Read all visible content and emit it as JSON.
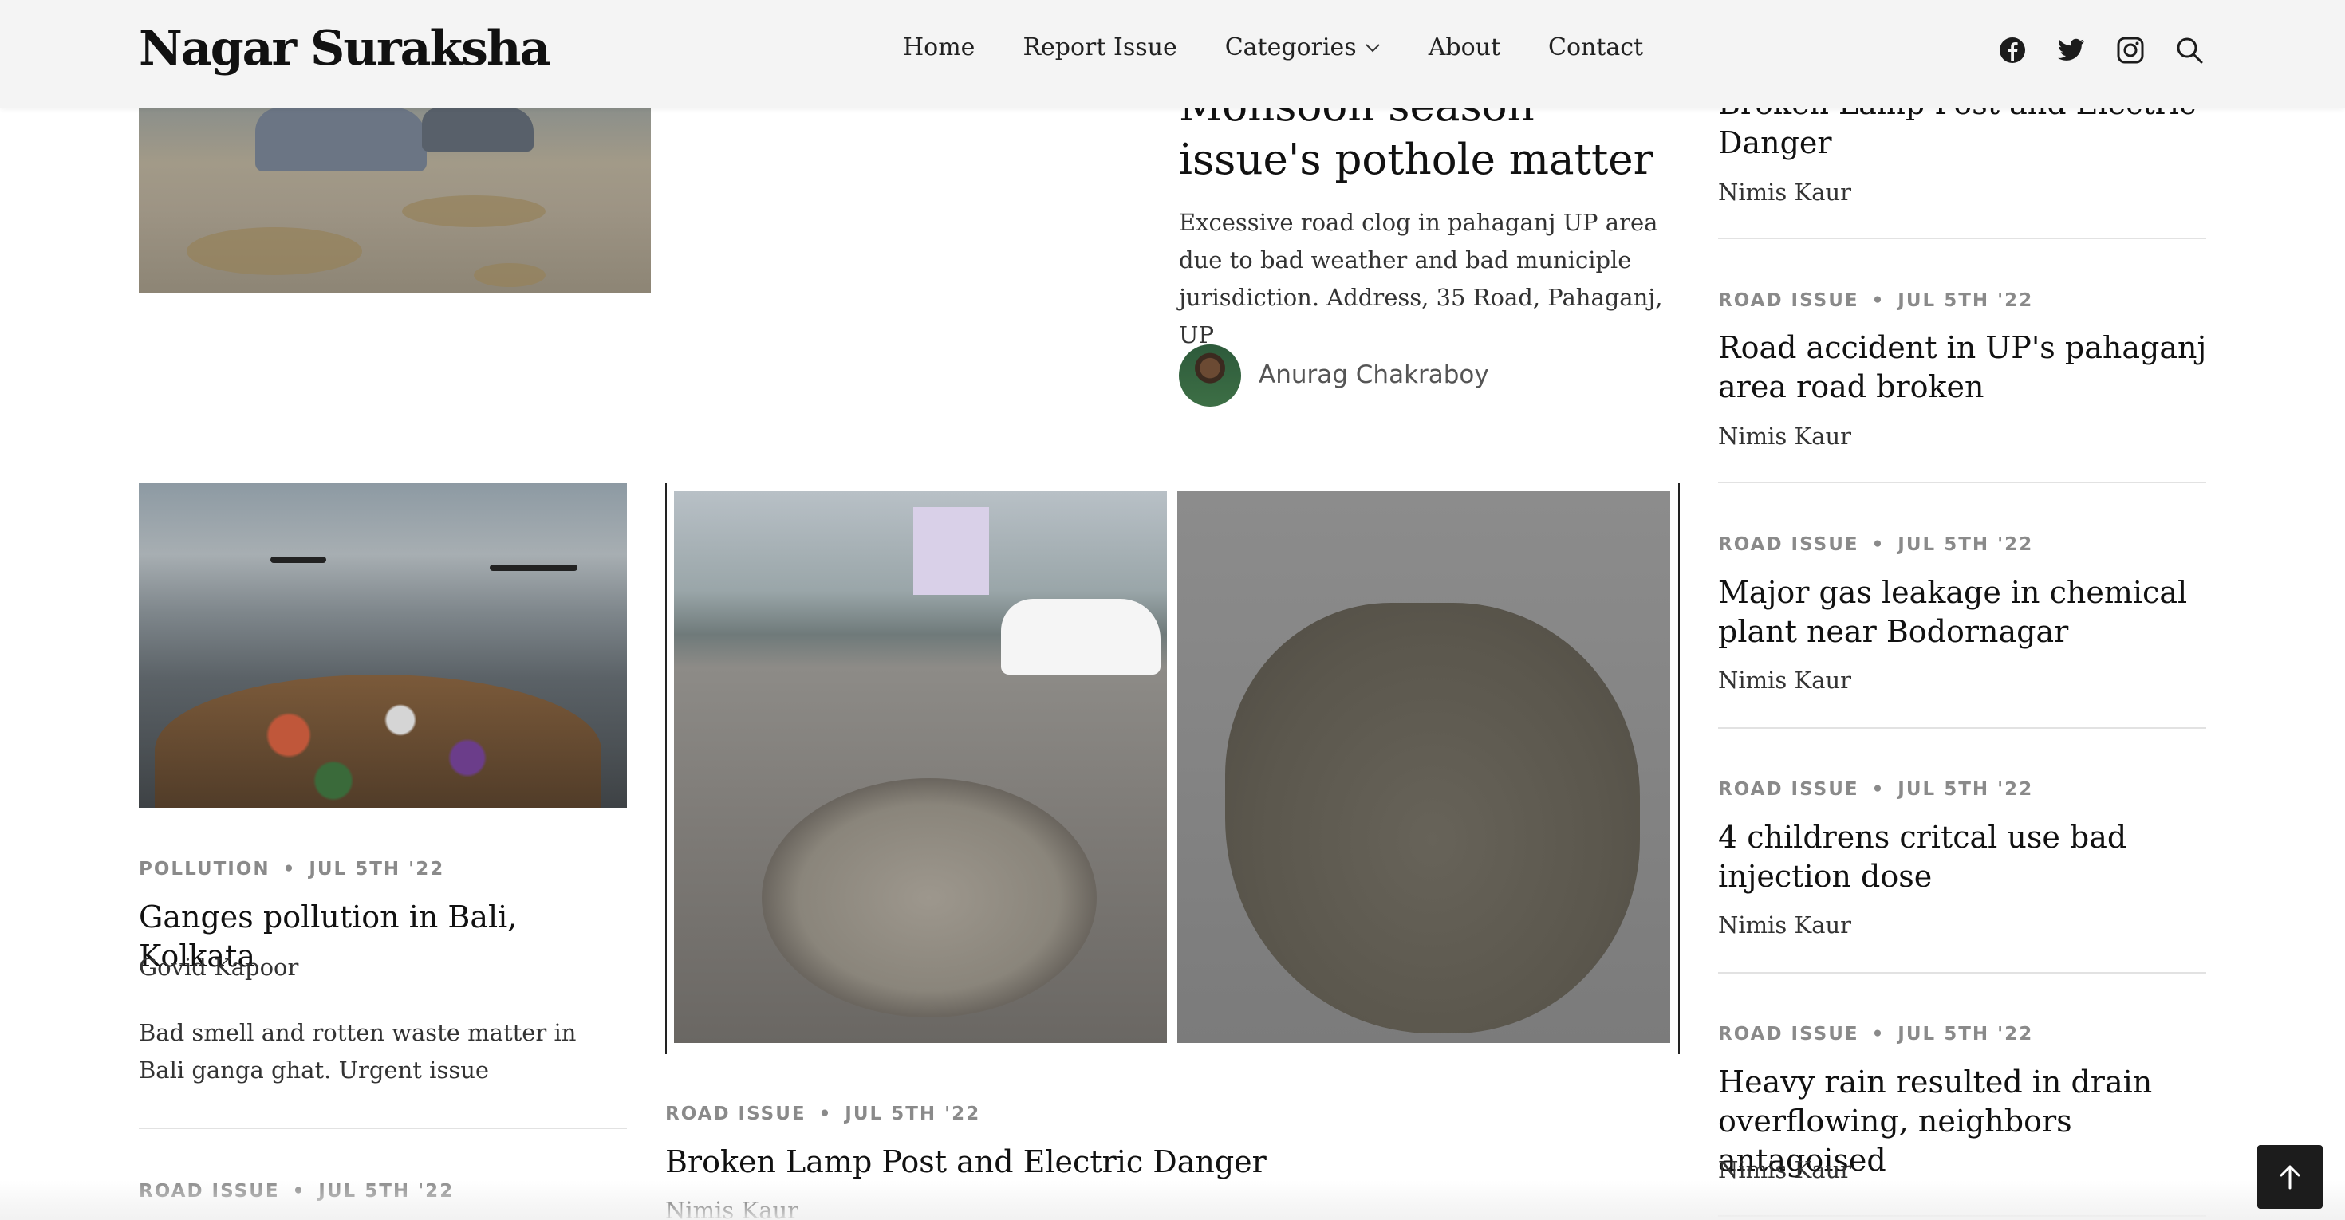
{
  "header": {
    "logo": "Nagar Suraksha",
    "nav": [
      {
        "label": "Home"
      },
      {
        "label": "Report Issue"
      },
      {
        "label": "Categories"
      },
      {
        "label": "About"
      },
      {
        "label": "Contact"
      }
    ],
    "social_icons": [
      "facebook-icon",
      "twitter-icon",
      "instagram-icon",
      "search-icon"
    ]
  },
  "featured": {
    "title": "Monsoon season issue's pothole matter",
    "excerpt": "Excessive road clog in pahaganj UP area due to bad weather and bad municiple jurisdiction. Address, 35 Road, Pahaganj, UP",
    "author": "Anurag Chakraboy"
  },
  "ganges": {
    "category": "Pollution",
    "date": "Jul 5th '22",
    "title": "Ganges pollution in Bali, Kolkata",
    "author": "Govid Kapoor",
    "excerpt": "Bad smell and rotten waste matter in Bali ganga ghat. Urgent issue"
  },
  "bottom_left": {
    "category": "Road Issue",
    "date": "Jul 5th '22"
  },
  "center_post": {
    "category": "Road Issue",
    "date": "Jul 5th '22",
    "title": "Broken Lamp Post and Electric Danger",
    "author": "Nimis Kaur"
  },
  "sidebar": {
    "top": {
      "title_line1": "Broken Lamp Post and Electric",
      "title_line2": "Danger",
      "author": "Nimis Kaur"
    },
    "items": [
      {
        "category": "Road Issue",
        "date": "Jul 5th '22",
        "title": "Road accident in UP's pahaganj area road broken",
        "author": "Nimis Kaur"
      },
      {
        "category": "Road Issue",
        "date": "Jul 5th '22",
        "title": "Major gas leakage in chemical plant near Bodornagar",
        "author": "Nimis Kaur"
      },
      {
        "category": "Road Issue",
        "date": "Jul 5th '22",
        "title": "4 childrens critcal use bad injection dose",
        "author": "Nimis Kaur"
      },
      {
        "category": "Road Issue",
        "date": "Jul 5th '22",
        "title": "Heavy rain resulted in drain overflowing, neighbors antagoised",
        "author": "Nimis Kaur"
      }
    ]
  },
  "colors": {
    "header_bg": "#f4f4f4",
    "meta_gray": "#8a8a8a",
    "button_dark": "#1c1c1c"
  }
}
